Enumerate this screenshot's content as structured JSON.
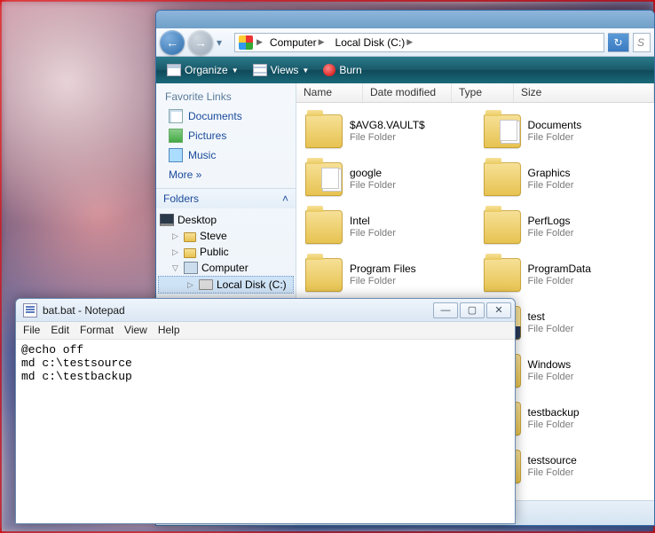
{
  "explorer": {
    "breadcrumb": {
      "seg1": "Computer",
      "seg2": "Local Disk (C:)"
    },
    "search_placeholder": "S",
    "toolbar": {
      "organize": "Organize",
      "views": "Views",
      "burn": "Burn"
    },
    "sidebar": {
      "fav_header": "Favorite Links",
      "documents": "Documents",
      "pictures": "Pictures",
      "music": "Music",
      "more": "More »",
      "folders_header": "Folders",
      "tree": {
        "desktop": "Desktop",
        "steve": "Steve",
        "public": "Public",
        "computer": "Computer",
        "drive": "Local Disk (C:)"
      }
    },
    "columns": {
      "name": "Name",
      "date": "Date modified",
      "type": "Type",
      "size": "Size"
    },
    "sub": "File Folder",
    "items": [
      {
        "name": "$AVG8.VAULT$"
      },
      {
        "name": "Documents"
      },
      {
        "name": "google"
      },
      {
        "name": "Graphics"
      },
      {
        "name": "Intel"
      },
      {
        "name": "PerfLogs"
      },
      {
        "name": "Program Files"
      },
      {
        "name": "ProgramData"
      },
      {
        "name": ""
      },
      {
        "name": "test"
      },
      {
        "name": ""
      },
      {
        "name": "Windows"
      },
      {
        "name": ""
      },
      {
        "name": "testbackup"
      },
      {
        "name": ""
      },
      {
        "name": "testsource"
      }
    ]
  },
  "notepad": {
    "title": "bat.bat - Notepad",
    "menu": {
      "file": "File",
      "edit": "Edit",
      "format": "Format",
      "view": "View",
      "help": "Help"
    },
    "content": "@echo off\nmd c:\\testsource\nmd c:\\testbackup"
  }
}
